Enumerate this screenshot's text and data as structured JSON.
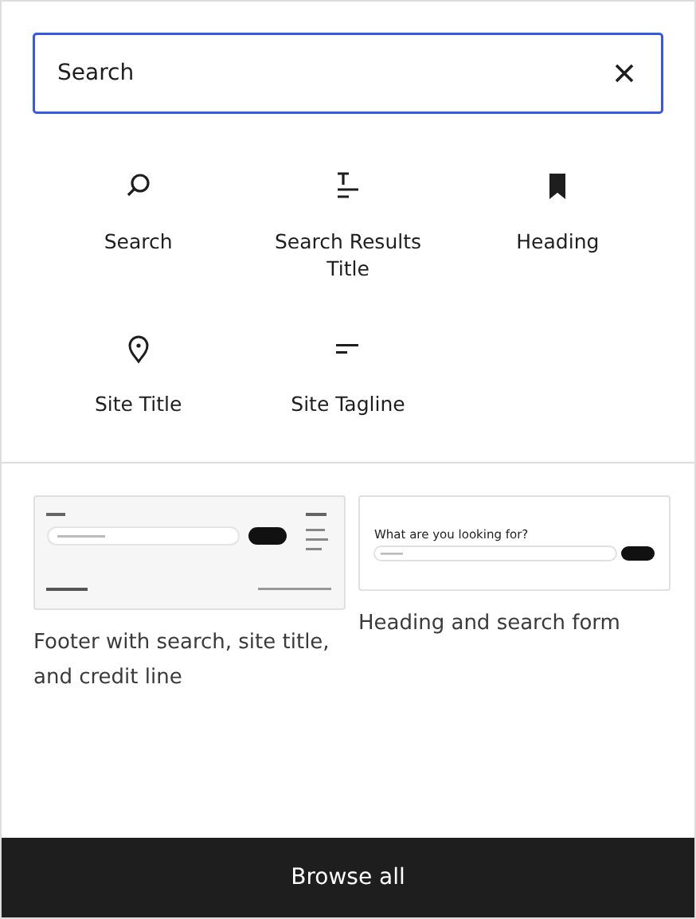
{
  "search": {
    "value": "Search"
  },
  "blocks": [
    {
      "label": "Search",
      "kind": "search"
    },
    {
      "label": "Search Results Title",
      "kind": "title"
    },
    {
      "label": "Heading",
      "kind": "heading"
    },
    {
      "label": "Site Title",
      "kind": "site-title"
    },
    {
      "label": "Site Tagline",
      "kind": "tagline"
    }
  ],
  "patterns": [
    {
      "kind": "footer",
      "label": "Footer with search, site title, and credit line"
    },
    {
      "kind": "heading-search",
      "label": "Heading and search form",
      "preview_heading": "What are you looking for?"
    }
  ],
  "footer_button": "Browse all"
}
